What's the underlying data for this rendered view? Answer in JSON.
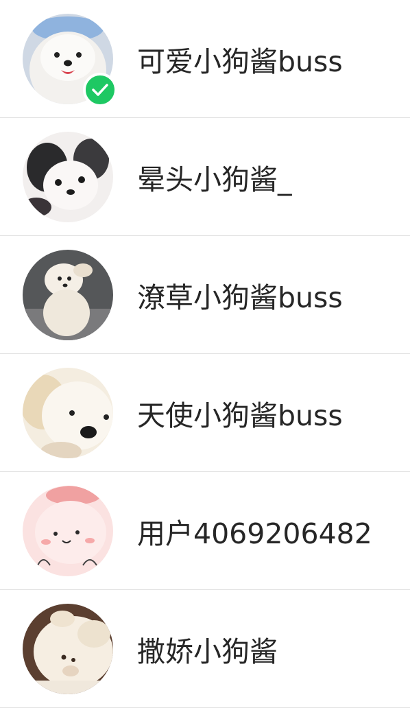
{
  "accounts": [
    {
      "name": "可爱小狗酱buss",
      "selected": true,
      "avatar": "white-samoyed-puppy"
    },
    {
      "name": "晕头小狗酱_",
      "selected": false,
      "avatar": "black-white-puppy"
    },
    {
      "name": "潦草小狗酱buss",
      "selected": false,
      "avatar": "fluffy-white-puppy-sitting"
    },
    {
      "name": "天使小狗酱buss",
      "selected": false,
      "avatar": "cream-puppy-closeup"
    },
    {
      "name": "用户4069206482",
      "selected": false,
      "avatar": "pink-cartoon-character"
    },
    {
      "name": "撒娇小狗酱",
      "selected": false,
      "avatar": "sleeping-white-puppy"
    }
  ],
  "colors": {
    "selected_badge": "#1ec863",
    "divider": "#e2e2e2",
    "name_text": "#262626"
  }
}
